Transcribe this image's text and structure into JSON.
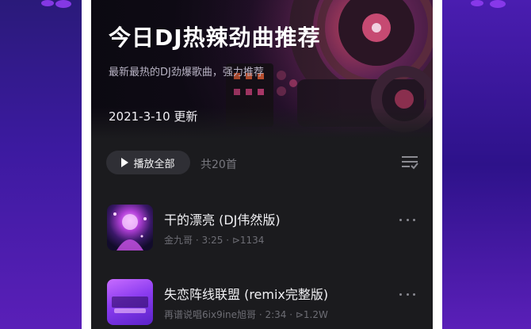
{
  "hero": {
    "title": "今日DJ热辣劲曲推荐",
    "subtitle": "最新最热的DJ劲爆歌曲，强力推荐",
    "updated": "2021-3-10 更新"
  },
  "toolbar": {
    "play_all_label": "播放全部",
    "count_label": "共20首"
  },
  "songs": [
    {
      "title": "干的漂亮 (DJ伟然版)",
      "meta": "金九哥 · 3:25 · ⊳1134"
    },
    {
      "title": "失恋阵线联盟 (remix完整版)",
      "meta": "再谱说唱6ix9ine旭哥 · 2:34 · ⊳1.2W"
    }
  ],
  "colors": {
    "background": "#1b1b1e",
    "accent": "#6a2ad0"
  },
  "icons": [
    "play-icon",
    "sort-list-icon",
    "more-icon"
  ]
}
